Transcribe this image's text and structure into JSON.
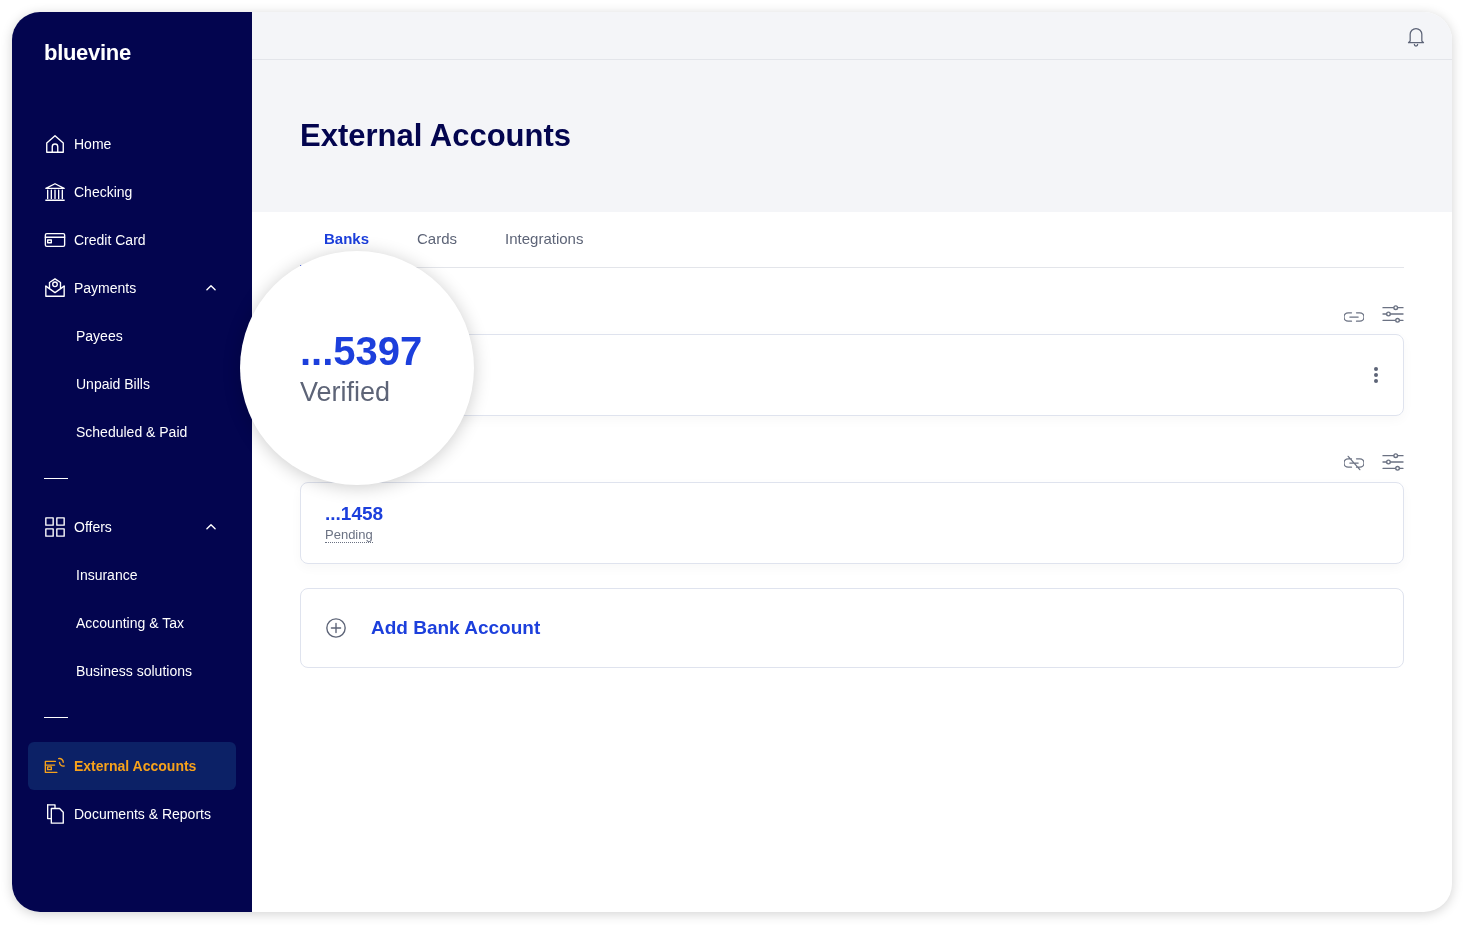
{
  "brand": "bluevine",
  "nav_groups": [
    {
      "items": [
        {
          "label": "Home",
          "selected": false
        },
        {
          "label": "Checking",
          "selected": false
        },
        {
          "label": "Credit Card",
          "selected": false
        },
        {
          "label": "Payments",
          "selected": false,
          "expanded": true,
          "children": [
            {
              "label": "Payees",
              "selected": false
            },
            {
              "label": "Unpaid Bills",
              "selected": false
            },
            {
              "label": "Scheduled & Paid",
              "selected": false
            }
          ]
        }
      ]
    },
    {
      "items": [
        {
          "label": "Offers",
          "selected": false,
          "expanded": true,
          "children": [
            {
              "label": "Insurance",
              "selected": false
            },
            {
              "label": "Accounting & Tax",
              "selected": false
            },
            {
              "label": "Business solutions",
              "selected": false
            }
          ]
        }
      ]
    },
    {
      "items": [
        {
          "label": "External Accounts",
          "selected": true
        },
        {
          "label": "Documents & Reports",
          "selected": false
        }
      ]
    }
  ],
  "page_title": "External Accounts",
  "tabs": [
    {
      "label": "Banks",
      "selected": true
    },
    {
      "label": "Cards",
      "selected": false
    },
    {
      "label": "Integrations",
      "selected": false
    }
  ],
  "accounts": [
    {
      "number": "...5397",
      "status": "Verified",
      "linked": true,
      "menu": true,
      "magnified": true
    },
    {
      "number": "...1458",
      "status": "Pending",
      "linked": false,
      "menu": false,
      "magnified": false
    }
  ],
  "add_button": "Add Bank Account"
}
